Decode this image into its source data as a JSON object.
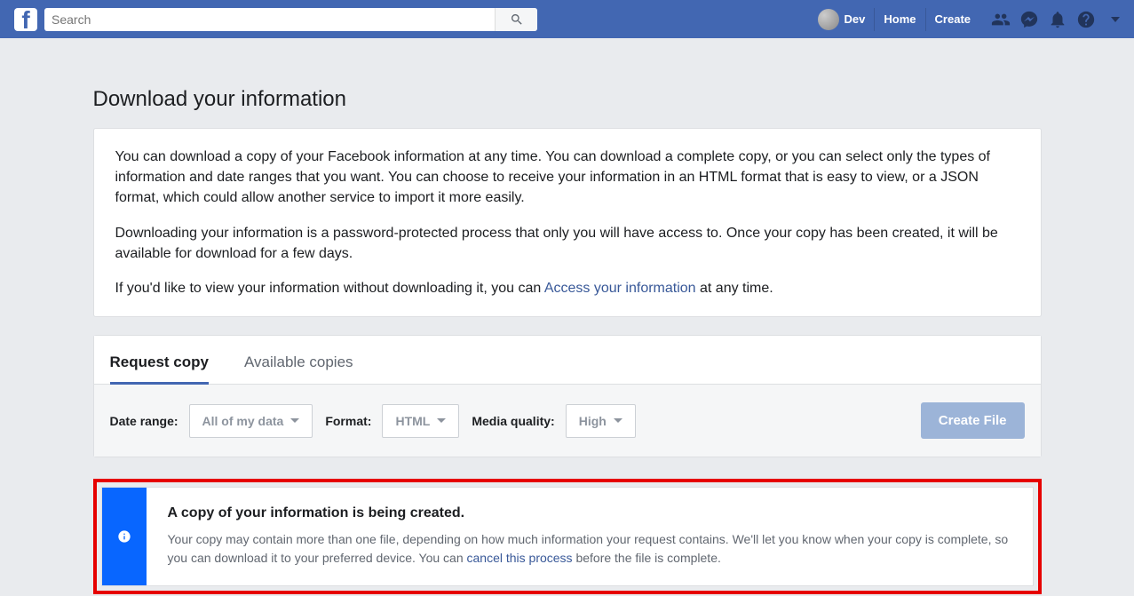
{
  "header": {
    "search_placeholder": "Search",
    "user_name": "Dev",
    "links": {
      "home": "Home",
      "create": "Create"
    }
  },
  "page": {
    "title": "Download your information"
  },
  "info": {
    "p1": "You can download a copy of your Facebook information at any time. You can download a complete copy, or you can select only the types of information and date ranges that you want. You can choose to receive your information in an HTML format that is easy to view, or a JSON format, which could allow another service to import it more easily.",
    "p2": "Downloading your information is a password-protected process that only you will have access to. Once your copy has been created, it will be available for download for a few days.",
    "p3_prefix": "If you'd like to view your information without downloading it, you can ",
    "p3_link": "Access your information",
    "p3_suffix": " at any time."
  },
  "tabs": {
    "request": "Request copy",
    "available": "Available copies"
  },
  "filters": {
    "date_range_label": "Date range:",
    "date_range_value": "All of my data",
    "format_label": "Format:",
    "format_value": "HTML",
    "media_label": "Media quality:",
    "media_value": "High",
    "create_button": "Create File"
  },
  "status": {
    "title": "A copy of your information is being created.",
    "text_prefix": "Your copy may contain more than one file, depending on how much information your request contains. We'll let you know when your copy is complete, so you can download it to your preferred device. You can ",
    "text_link": "cancel this process",
    "text_suffix": " before the file is complete."
  }
}
